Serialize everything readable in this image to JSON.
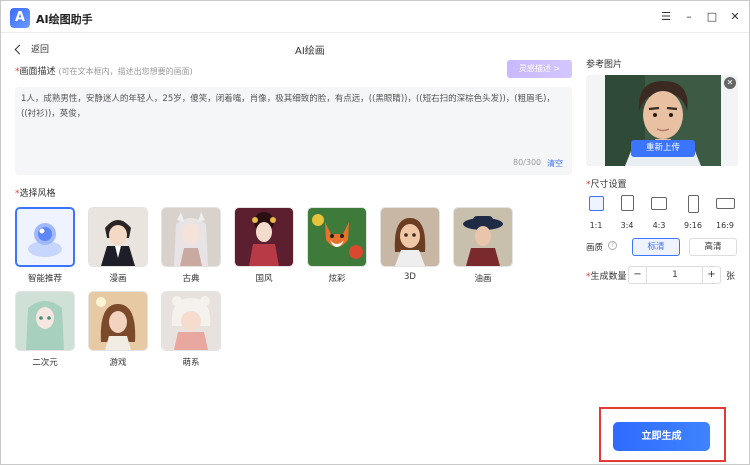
{
  "app": {
    "logo_letter": "A",
    "title": "AI绘图助手"
  },
  "nav": {
    "back_label": "返回",
    "page_title": "AI绘画"
  },
  "prompt": {
    "label": "画面描述",
    "hint": "(可在文本框内，描述出您想要的画面)",
    "inspire_label": "灵感描述 >",
    "text": "1人，成熟男性，安静迷人的年轻人，25岁，傻笑，闭着嘴，肖像，极其细致的脸，有点远，((黑眼睛))，((短右扫的深棕色头发))，(粗眉毛)，((衬衫))，英俊，",
    "counter": "80/300",
    "clear_label": "清空"
  },
  "styles": {
    "label": "选择风格",
    "items": [
      {
        "label": "智能推荐",
        "selected": true
      },
      {
        "label": "漫画",
        "selected": false
      },
      {
        "label": "古典",
        "selected": false
      },
      {
        "label": "国风",
        "selected": false
      },
      {
        "label": "炫彩",
        "selected": false
      },
      {
        "label": "3D",
        "selected": false
      },
      {
        "label": "油画",
        "selected": false
      },
      {
        "label": "二次元",
        "selected": false
      },
      {
        "label": "游戏",
        "selected": false
      },
      {
        "label": "萌系",
        "selected": false
      }
    ]
  },
  "reference": {
    "label": "参考图片",
    "reupload_label": "重新上传"
  },
  "size": {
    "label": "尺寸设置",
    "ratios": [
      {
        "label": "1:1",
        "selected": true
      },
      {
        "label": "3:4",
        "selected": false
      },
      {
        "label": "4:3",
        "selected": false
      },
      {
        "label": "9:16",
        "selected": false
      },
      {
        "label": "16:9",
        "selected": false
      }
    ]
  },
  "quality": {
    "label": "画质",
    "options": [
      {
        "label": "标清",
        "selected": true
      },
      {
        "label": "高清",
        "selected": false
      }
    ]
  },
  "count": {
    "label": "生成数量",
    "value": "1",
    "unit": "张"
  },
  "generate_label": "立即生成",
  "colors": {
    "accent": "#3a74ff",
    "required": "#e53935",
    "highlight_frame": "#e53935"
  }
}
